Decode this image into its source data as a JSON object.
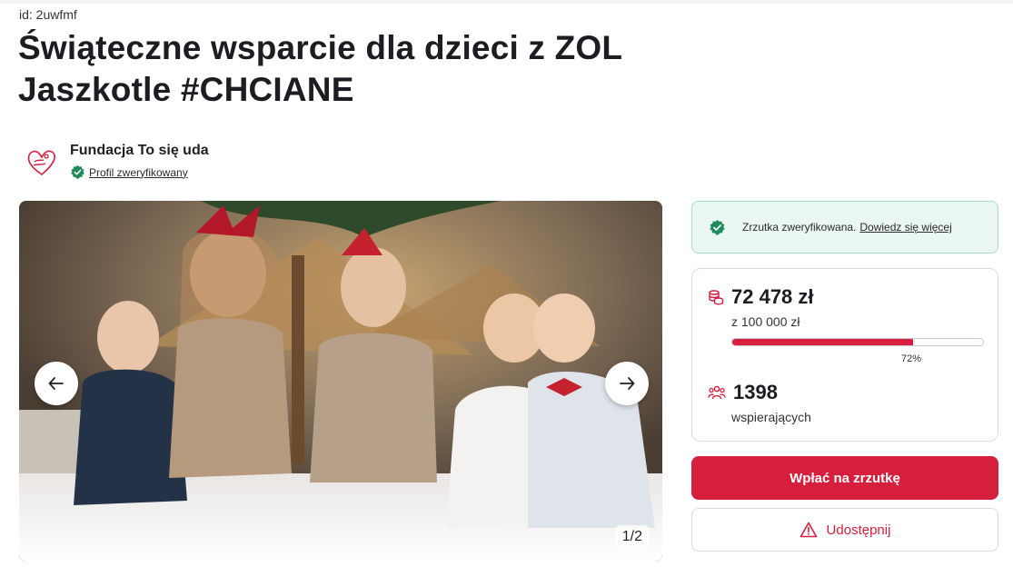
{
  "page": {
    "id_label": "id: 2uwfmf",
    "title_line1": "Świąteczne wsparcie dla dzieci z ZOL",
    "title_line2": "Jaszkotle #CHCIANE"
  },
  "organizer": {
    "name": "Fundacja To się uda",
    "verified_label": "Profil zweryfikowany"
  },
  "gallery": {
    "counter": "1/2",
    "prev_icon": "arrow-left-icon",
    "next_icon": "arrow-right-icon"
  },
  "verification": {
    "text": "Zrzutka zweryfikowana.",
    "link": "Dowiedz się więcej"
  },
  "stats": {
    "amount": "72 478 zł",
    "goal": "z 100 000 zł",
    "progress_percent": 72,
    "progress_label": "72%",
    "supporters": "1398",
    "supporters_label": "wspierających"
  },
  "actions": {
    "donate_label": "Wpłać na zrzutkę",
    "share_label": "Udostępnij"
  },
  "colors": {
    "accent": "#d51f3c",
    "verified_green": "#1f8a5b",
    "verified_bg": "#e9f6f1"
  }
}
